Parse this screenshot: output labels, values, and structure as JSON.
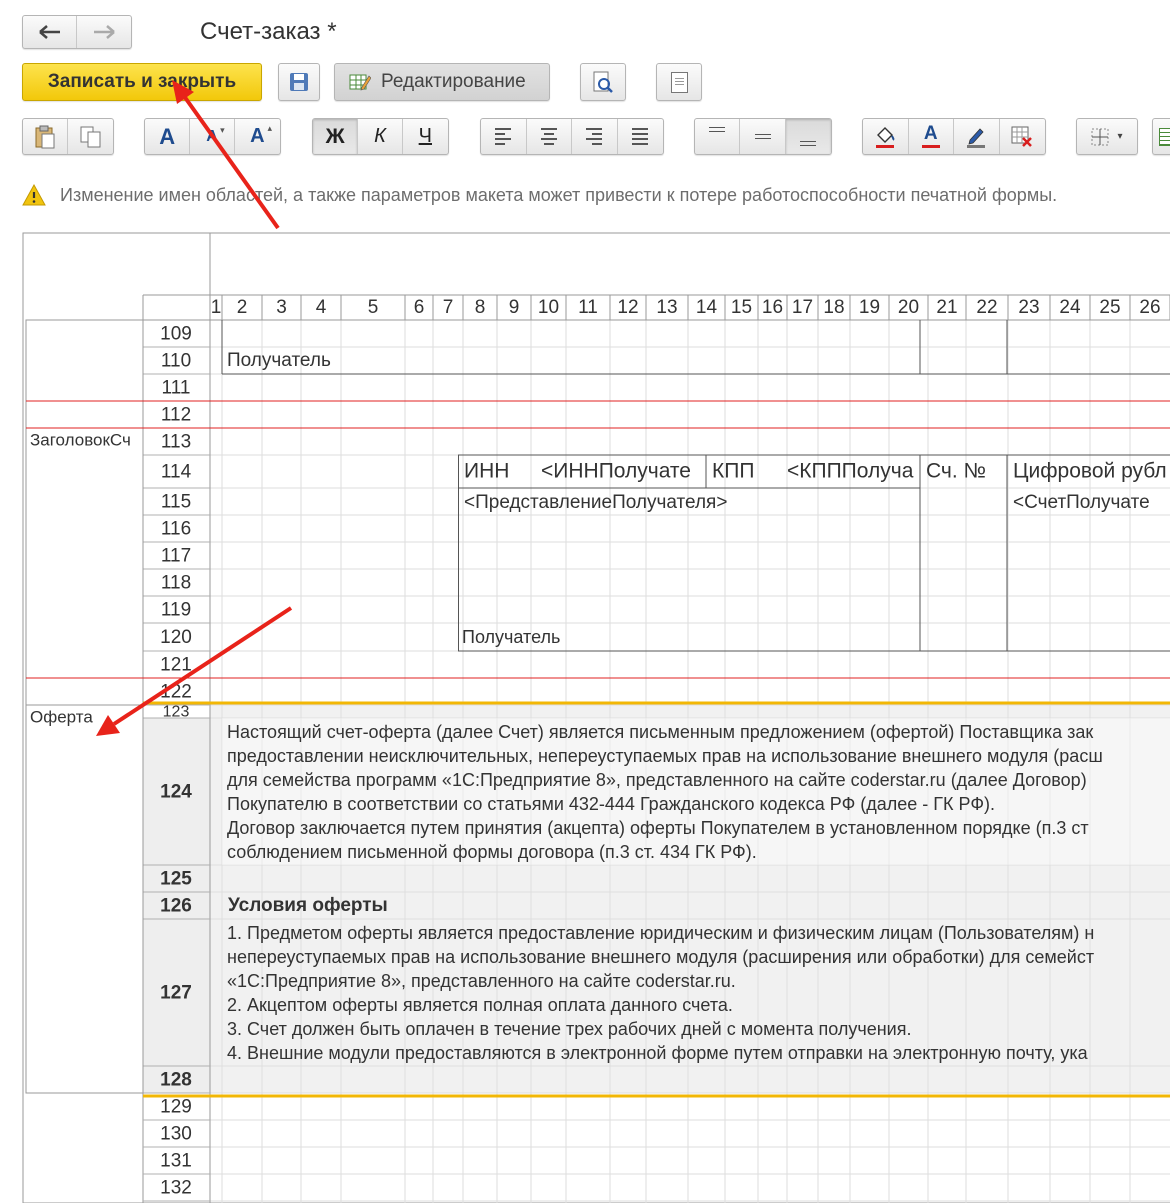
{
  "window": {
    "title": "Счет-заказ *"
  },
  "toolbar": {
    "save_close_label": "Записать и закрыть",
    "edit_mode_label": "Редактирование",
    "font_inc_label": "A",
    "font_dec_label": "A",
    "font_larger_label": "A",
    "bold_label": "Ж",
    "italic_label": "К",
    "underline_label": "Ч",
    "font_color_label": "A"
  },
  "warning": {
    "text": "Изменение имен областей, а также параметров макета может привести к потере работоспособности печатной формы."
  },
  "colors": {
    "accent": "#f5d316",
    "warn": "#f1c40f",
    "annotation": "#e8231a",
    "area_line": "#e02020",
    "section_line": "#f2b705"
  },
  "columns": [
    "1",
    "2",
    "3",
    "4",
    "5",
    "6",
    "7",
    "8",
    "9",
    "10",
    "11",
    "12",
    "13",
    "14",
    "15",
    "16",
    "17",
    "18",
    "19",
    "20",
    "21",
    "22",
    "23",
    "24",
    "25",
    "26"
  ],
  "rows": [
    "109",
    "110",
    "111",
    "112",
    "113",
    "114",
    "115",
    "116",
    "117",
    "118",
    "119",
    "120",
    "121",
    "122",
    "123",
    "124",
    "125",
    "126",
    "127",
    "128",
    "129",
    "130",
    "131",
    "132"
  ],
  "areas": {
    "header": "ЗаголовокСч",
    "offer": "Оферта"
  },
  "cells": {
    "r110": "Получатель",
    "inn_label": "ИНН",
    "inn_param": "<ИННПолучате",
    "kpp_label": "КПП",
    "kpp_param": "<КПППолуча",
    "acc_no": "Сч. №",
    "digital": "Цифровой рубл",
    "recipient_param": "<ПредставлениеПолучателя>",
    "account_param": "<СчетПолучате",
    "r120": "Получатель",
    "offer_text": [
      "Настоящий счет-оферта (далее Счет) является письменным предложением (офертой) Поставщика зак",
      "предоставлении неисключительных, непереуступаемых прав на использование внешнего модуля (расш",
      "для семейства программ «1С:Предприятие 8», представленного на сайте coderstar.ru (далее Договор)",
      "Покупателю в соответствии со статьями 432-444 Гражданского кодекса РФ (далее - ГК РФ).",
      "Договор заключается путем принятия (акцепта) оферты Покупателем в установленном порядке (п.3 ст",
      "соблюдением письменной формы договора (п.3 ст. 434 ГК РФ)."
    ],
    "conditions_title": "Условия оферты",
    "conditions_text": [
      "1. Предметом оферты является предоставление юридическим и физическим лицам (Пользователям) н",
      "непереуступаемых прав на использование внешнего модуля (расширения или обработки) для семейст",
      "«1С:Предприятие 8», представленного на сайте coderstar.ru.",
      "2. Акцептом оферты является полная оплата данного счета.",
      "3. Счет должен быть оплачен в течение трех рабочих дней с момента получения.",
      "4. Внешние модули предоставляются в электронной форме путем отправки на электронную почту, ука"
    ]
  }
}
